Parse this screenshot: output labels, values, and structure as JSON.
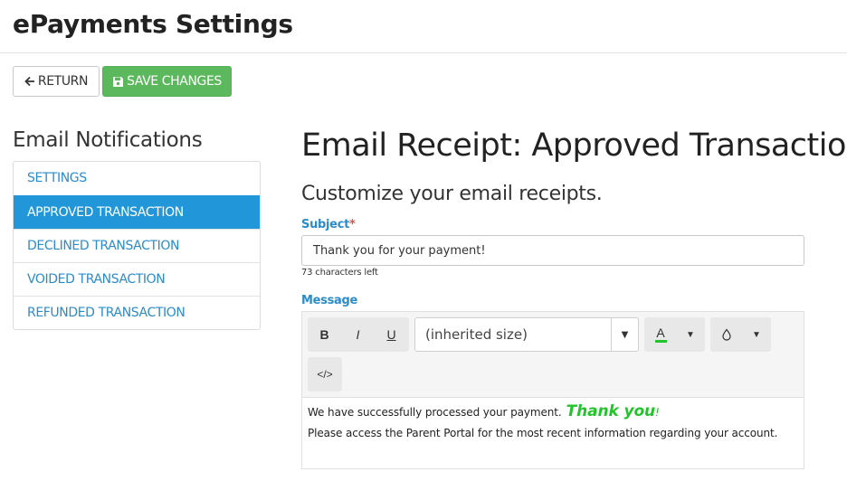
{
  "header": {
    "title": "ePayments Settings"
  },
  "toolbar": {
    "return_label": "RETURN",
    "save_label": "SAVE CHANGES"
  },
  "colors": {
    "accent": "#2196d8",
    "save": "#5cb85c",
    "link": "#2b8ccb",
    "highlight_text": "#22c42a"
  },
  "sidebar": {
    "title": "Email Notifications",
    "items": [
      {
        "label": "SETTINGS",
        "active": false
      },
      {
        "label": "APPROVED TRANSACTION",
        "active": true
      },
      {
        "label": "DECLINED TRANSACTION",
        "active": false
      },
      {
        "label": "VOIDED TRANSACTION",
        "active": false
      },
      {
        "label": "REFUNDED TRANSACTION",
        "active": false
      }
    ]
  },
  "main": {
    "title": "Email Receipt: Approved Transactions",
    "subtitle": "Customize your email receipts.",
    "subject": {
      "label": "Subject",
      "required_mark": "*",
      "value": "Thank you for your payment!",
      "chars_left": "73 characters left"
    },
    "message": {
      "label": "Message",
      "toolbar": {
        "bold": "B",
        "italic": "I",
        "underline": "U",
        "font_size": "(inherited size)",
        "text_color_letter": "A",
        "code_label": "</>"
      },
      "body": {
        "line1_text": "We have successfully processed your payment.",
        "line1_highlight": "Thank you",
        "line1_end": "!",
        "line2_text": "Please access the Parent Portal for the most recent information regarding your account."
      }
    }
  }
}
